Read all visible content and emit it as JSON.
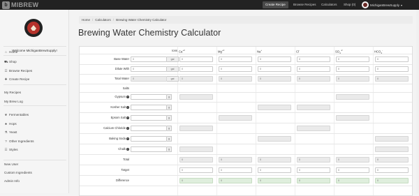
{
  "app": {
    "logo_text": "MIBREW",
    "logo_glyph": "b"
  },
  "topnav": {
    "create_recipe": "Create Recipe",
    "browse_recipes": "Browse Recipes",
    "calculators": "Calculators",
    "shop": "Shop (0)",
    "user_name": "MichiganBrewSupply",
    "caret": "▾"
  },
  "sidebar": {
    "welcome": "Welcome MichiganBrewSupply!",
    "items": [
      {
        "label": "Home",
        "icon": "home-icon",
        "glyph": "⌂"
      },
      {
        "label": "Shop",
        "icon": "cart-icon",
        "glyph": "⛟"
      },
      {
        "label": "Browse Recipes",
        "icon": "list-icon",
        "glyph": "☰"
      },
      {
        "label": "Create Recipe",
        "icon": "plus-icon",
        "glyph": "✚"
      },
      {
        "label": "My Recipes",
        "icon": "",
        "glyph": ""
      },
      {
        "label": "My Brew Log",
        "icon": "",
        "glyph": ""
      },
      {
        "label": "Fermentables",
        "icon": "grain-icon",
        "glyph": "❦"
      },
      {
        "label": "Hops",
        "icon": "hop-icon",
        "glyph": "♣"
      },
      {
        "label": "Yeast",
        "icon": "flask-icon",
        "glyph": "⚗"
      },
      {
        "label": "Other Ingredients",
        "icon": "question-icon",
        "glyph": "?"
      },
      {
        "label": "Styles",
        "icon": "list-icon",
        "glyph": "☰"
      },
      {
        "label": "New User",
        "icon": "",
        "glyph": ""
      },
      {
        "label": "Custom Ingredients",
        "icon": "",
        "glyph": ""
      },
      {
        "label": "Admin Info",
        "icon": "",
        "glyph": ""
      }
    ]
  },
  "breadcrumb": [
    "Home",
    "Calculators",
    "Brewing Water Chemistry Calculator"
  ],
  "page_title": "Brewing Water Chemistry Calculator",
  "table": {
    "ions_label": "Ions",
    "ion_headers": [
      {
        "base": "Ca",
        "sup": "+2",
        "sub": ""
      },
      {
        "base": "Mg",
        "sup": "+2",
        "sub": ""
      },
      {
        "base": "Na",
        "sup": "+",
        "sub": ""
      },
      {
        "base": "Cl",
        "sup": "-",
        "sub": ""
      },
      {
        "base": "SO",
        "sup": "-2",
        "sub": "4"
      },
      {
        "base": "HCO",
        "sup": "-",
        "sub": "3"
      }
    ],
    "volume_rows": [
      {
        "label": "Base Water",
        "value": "0",
        "unit": "gal",
        "ions": [
          "0",
          "0",
          "0",
          "0",
          "0",
          "0"
        ],
        "readonly_ions": false
      },
      {
        "label": "Dilute With",
        "value": "0",
        "unit": "gal",
        "ions": [
          "0",
          "0",
          "0",
          "0",
          "0",
          "0"
        ],
        "readonly_ions": false
      },
      {
        "label": "Total Water",
        "value": "0",
        "unit": "gal",
        "ions": [
          "0",
          "0",
          "0",
          "0",
          "0",
          "0"
        ],
        "readonly_ions": true
      }
    ],
    "salts_label": "Salts",
    "salt_rows": [
      {
        "label": "Gypsum",
        "help": true,
        "unit": "g",
        "cells": [
          true,
          false,
          false,
          false,
          true,
          false
        ]
      },
      {
        "label": "Kosher Salt",
        "help": true,
        "unit": "g",
        "cells": [
          false,
          false,
          true,
          true,
          false,
          false
        ]
      },
      {
        "label": "Epsom Salt",
        "help": true,
        "unit": "g",
        "cells": [
          false,
          true,
          false,
          false,
          true,
          false
        ]
      },
      {
        "label": "Calcium Chloride",
        "help": true,
        "unit": "g",
        "cells": [
          true,
          false,
          false,
          true,
          false,
          false
        ]
      },
      {
        "label": "Baking Soda",
        "help": true,
        "unit": "g",
        "cells": [
          false,
          false,
          true,
          false,
          false,
          true
        ]
      },
      {
        "label": "Chalk",
        "help": true,
        "unit": "g",
        "cells": [
          true,
          false,
          false,
          false,
          false,
          true
        ]
      }
    ],
    "summary_rows": [
      {
        "label": "Total",
        "ions": [
          "0",
          "0",
          "0",
          "0",
          "0",
          "0"
        ],
        "style": "ro"
      },
      {
        "label": "Target",
        "ions": [
          "0",
          "0",
          "0",
          "0",
          "0",
          "0"
        ],
        "style": "plain"
      },
      {
        "label": "Difference",
        "ions": [
          "0",
          "0",
          "0",
          "0",
          "0",
          "0"
        ],
        "style": "diff"
      }
    ]
  }
}
